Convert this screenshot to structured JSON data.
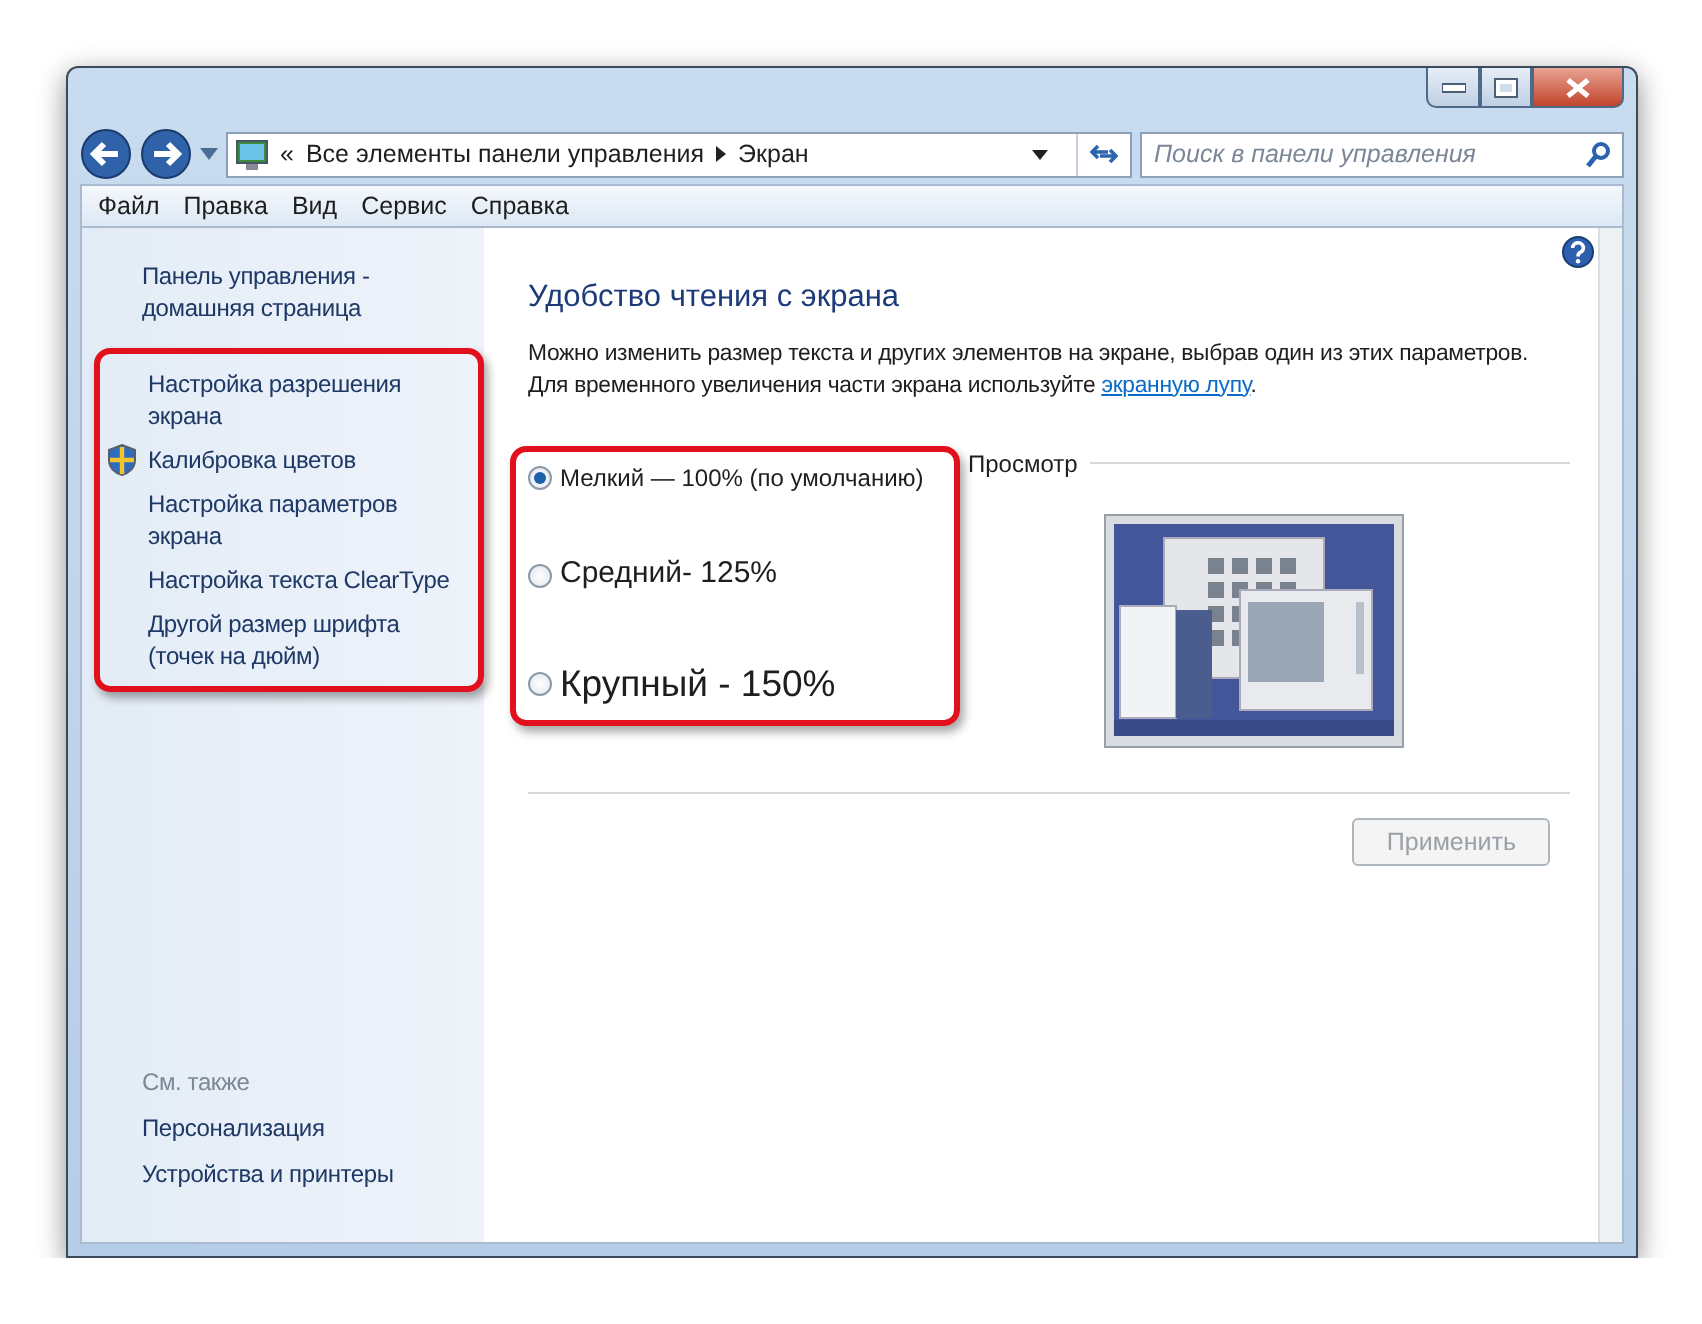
{
  "window": {
    "controls": [
      {
        "kind": "minimize"
      },
      {
        "kind": "maximize"
      },
      {
        "kind": "close"
      }
    ]
  },
  "address_bar": {
    "overflow": "«",
    "segments": [
      "Все элементы панели управления",
      "Экран"
    ]
  },
  "search": {
    "placeholder": "Поиск в панели управления"
  },
  "menu": [
    "Файл",
    "Правка",
    "Вид",
    "Сервис",
    "Справка"
  ],
  "sidebar": {
    "home_link": "Панель управления - домашняя страница",
    "tasks_highlighted": true,
    "tasks": [
      {
        "label": "Настройка разрешения экрана",
        "shield": false
      },
      {
        "label": "Калибровка цветов",
        "shield": true
      },
      {
        "label": "Настройка параметров экрана",
        "shield": false
      },
      {
        "label": "Настройка текста ClearType",
        "shield": false
      },
      {
        "label": "Другой размер шрифта (точек на дюйм)",
        "shield": false
      }
    ],
    "see_also_heading": "См. также",
    "see_also": [
      "Персонализация",
      "Устройства и принтеры"
    ]
  },
  "main": {
    "title": "Удобство чтения с экрана",
    "description": {
      "line_1": "Можно изменить размер текста и других элементов на экране, выбрав один из этих параметров.",
      "line_2": "Для временного увеличения части экрана используйте ",
      "link": "экранную лупу",
      "end": "."
    },
    "options_highlighted": true,
    "options": [
      {
        "label": "Мелкий — 100% (по умолчанию)",
        "selected": true,
        "kind": "small"
      },
      {
        "label": "Средний- 125%",
        "selected": false,
        "kind": "medium"
      },
      {
        "label": "Крупный - 150%",
        "selected": false,
        "kind": "large"
      }
    ],
    "preview_label": "Просмотр",
    "apply_button": {
      "label": "Применить",
      "disabled": true
    }
  }
}
